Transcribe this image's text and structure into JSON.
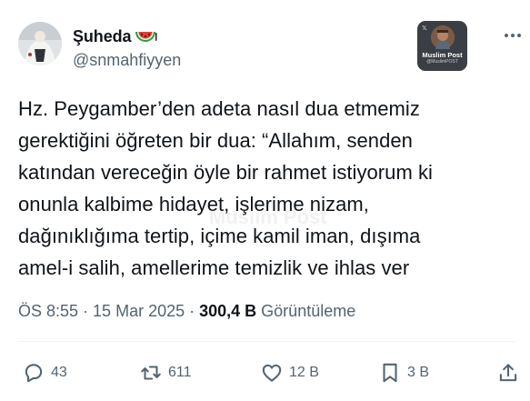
{
  "author": {
    "display_name": "Şuheda",
    "handle": "@snmahfiyyen",
    "name_emoji": "watermelon-icon"
  },
  "badge": {
    "title": "Muslim Post",
    "subtitle": "@MuslimPOST"
  },
  "tweet": {
    "lines": [
      "Hz. Peygamber’den adeta nasıl dua etmemiz",
      "gerektiğini öğreten bir dua: “Allahım, senden",
      "katından vereceğin öyle bir rahmet istiyorum ki",
      "onunla kalbime hidayet, işlerime nizam,",
      "dağınıklığıma tertip, içime kamil iman, dışıma",
      "amel-i salih, amellerime temizlik ve ihlas ver"
    ],
    "watermark": "Muslim Post"
  },
  "meta": {
    "time": "ÖS 8:55",
    "separator": "·",
    "date": "15 Mar 2025",
    "views": "300,4 B",
    "views_label": "Görüntüleme"
  },
  "actions": {
    "replies": "43",
    "reposts": "611",
    "likes": "12 B",
    "bookmarks": "3 B"
  },
  "colors": {
    "text": "#0f1419",
    "secondary": "#536471",
    "divider": "#eff3f4"
  }
}
